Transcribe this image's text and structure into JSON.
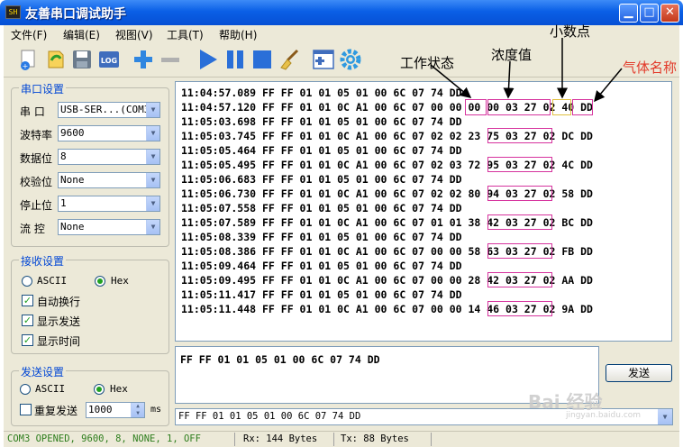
{
  "window": {
    "title": "友善串口调试助手",
    "icon_text": "SH"
  },
  "menu": [
    "文件(F)",
    "编辑(E)",
    "视图(V)",
    "工具(T)",
    "帮助(H)"
  ],
  "serial_settings": {
    "title": "串口设置",
    "rows": [
      {
        "label": "串  口",
        "value": "USB-SER...(COM3)"
      },
      {
        "label": "波特率",
        "value": "9600"
      },
      {
        "label": "数据位",
        "value": "8"
      },
      {
        "label": "校验位",
        "value": "None"
      },
      {
        "label": "停止位",
        "value": "1"
      },
      {
        "label": "流  控",
        "value": "None"
      }
    ]
  },
  "receive_settings": {
    "title": "接收设置",
    "ascii_label": "ASCII",
    "hex_label": "Hex",
    "auto_wrap": "自动换行",
    "show_send": "显示发送",
    "show_time": "显示时间"
  },
  "send_settings": {
    "title": "发送设置",
    "ascii_label": "ASCII",
    "hex_label": "Hex",
    "repeat_label": "重复发送",
    "interval": "1000",
    "unit": "ms"
  },
  "receive_lines": [
    "11:04:57.089 FF FF 01 01 05 01 00 6C 07 74 DD",
    "11:04:57.120 FF FF 01 01 0C A1 00 6C 07 00 00 00 00 03 27 02 40 DD",
    "11:05:03.698 FF FF 01 01 05 01 00 6C 07 74 DD",
    "11:05:03.745 FF FF 01 01 0C A1 00 6C 07 02 02 23 75 03 27 02 DC DD",
    "11:05:05.464 FF FF 01 01 05 01 00 6C 07 74 DD",
    "11:05:05.495 FF FF 01 01 0C A1 00 6C 07 02 03 72 95 03 27 02 4C DD",
    "11:05:06.683 FF FF 01 01 05 01 00 6C 07 74 DD",
    "11:05:06.730 FF FF 01 01 0C A1 00 6C 07 02 02 80 94 03 27 02 58 DD",
    "11:05:07.558 FF FF 01 01 05 01 00 6C 07 74 DD",
    "11:05:07.589 FF FF 01 01 0C A1 00 6C 07 01 01 38 42 03 27 02 BC DD",
    "11:05:08.339 FF FF 01 01 05 01 00 6C 07 74 DD",
    "11:05:08.386 FF FF 01 01 0C A1 00 6C 07 00 00 58 63 03 27 02 FB DD",
    "11:05:09.464 FF FF 01 01 05 01 00 6C 07 74 DD",
    "11:05:09.495 FF FF 01 01 0C A1 00 6C 07 00 00 28 42 03 27 02 AA DD",
    "11:05:11.417 FF FF 01 01 05 01 00 6C 07 74 DD",
    "11:05:11.448 FF FF 01 01 0C A1 00 6C 07 00 00 14 46 03 27 02 9A DD"
  ],
  "send_text": "FF FF 01 01 05 01 00 6C 07 74 DD",
  "send_button": "发送",
  "history_value": "FF FF 01 01 05 01 00 6C 07 74 DD",
  "status": {
    "port": "COM3 OPENED, 9600, 8, NONE, 1, OFF",
    "rx": "Rx: 144 Bytes",
    "tx": "Tx: 88 Bytes"
  },
  "annotations": {
    "work_state": "工作状态",
    "concentration": "浓度值",
    "decimal": "小数点",
    "gas_name": "气体名称"
  },
  "watermark": {
    "main": "Bai 经验",
    "sub": "jingyan.baidu.com"
  },
  "colors": {
    "status_text": "#2d7d1c",
    "group_title": "#0046d5",
    "highlight": "#d6339e",
    "annotation_red": "#e23a2a"
  }
}
